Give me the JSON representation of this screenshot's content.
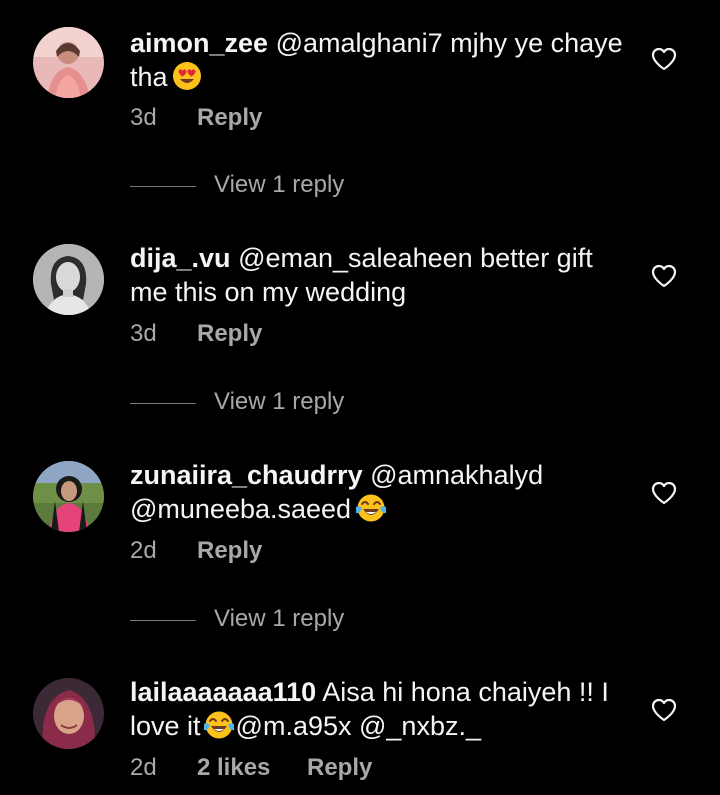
{
  "comments": [
    {
      "username": "aimon_zee",
      "text": "@amalghani7 mjhy ye chaye tha",
      "emoji": "heart-eyes",
      "time": "3d",
      "reply": "Reply",
      "view_replies": "View 1 reply"
    },
    {
      "username": "dija_.vu",
      "text": "@eman_saleaheen better gift me this on my wedding",
      "time": "3d",
      "reply": "Reply",
      "view_replies": "View 1 reply"
    },
    {
      "username": "zunaiira_chaudrry",
      "text": "@amnakhalyd @muneeba.saeed",
      "emoji": "tears-of-joy",
      "time": "2d",
      "reply": "Reply",
      "view_replies": "View 1 reply"
    },
    {
      "username": "lailaaaaaaa110",
      "text_before": "Aisa hi hona chaiyeh !! I love it",
      "emoji": "tears-of-joy",
      "text_after": "@m.a95x @_nxbz._",
      "time": "2d",
      "likes": "2 likes",
      "reply": "Reply"
    }
  ],
  "icons": {
    "like": "heart-outline-icon"
  },
  "colors": {
    "background": "#000000",
    "primary_text": "#f5f5f5",
    "secondary_text": "#a8a8a8"
  }
}
